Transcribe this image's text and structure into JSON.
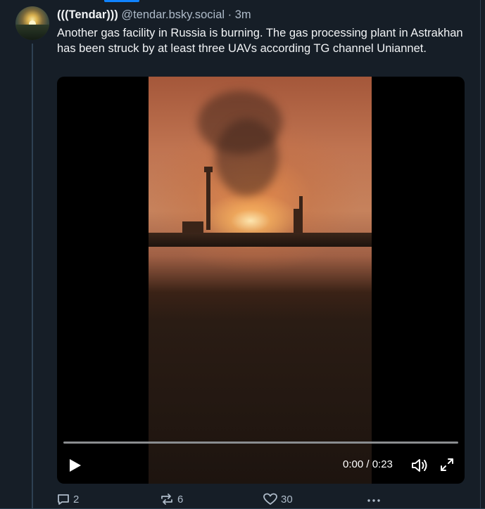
{
  "post": {
    "author_name": "(((Tendar)))",
    "handle": "@tendar.bsky.social",
    "separator": "·",
    "time_ago": "3m",
    "text": "Another gas facility in Russia is burning. The gas processing plant in Astrakhan  has been struck by at least three UAVs according TG channel Uniannet."
  },
  "video": {
    "time_display": "0:00 / 0:23",
    "progress": 0
  },
  "actions": {
    "replies": "2",
    "reposts": "6",
    "likes": "30"
  },
  "icons": {
    "avatar": "avatar-image",
    "play": "play-icon",
    "volume": "volume-icon",
    "fullscreen": "fullscreen-icon",
    "reply": "reply-icon",
    "repost": "repost-icon",
    "like": "heart-icon",
    "more": "more-icon"
  },
  "colors": {
    "background": "#161e27",
    "accent": "#1083fe",
    "text_primary": "#f1f3f5",
    "text_secondary": "#aebbc9"
  }
}
